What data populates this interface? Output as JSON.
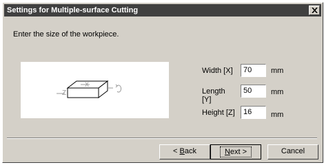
{
  "dialog": {
    "title": "Settings for Multiple-surface Cutting",
    "instruction": "Enter the size of the workpiece.",
    "preview": {
      "axis_z": "Z",
      "axis_x": "X"
    },
    "fields": [
      {
        "label": "Width [X]",
        "value": "70",
        "unit": "mm"
      },
      {
        "label": "Length [Y]",
        "value": "50",
        "unit": "mm"
      },
      {
        "label": "Height [Z]",
        "value": "16",
        "unit": "mm"
      }
    ],
    "buttons": {
      "back_prefix": "< ",
      "back_mnemonic": "B",
      "back_rest": "ack",
      "next_mnemonic": "N",
      "next_rest": "ext >",
      "cancel": "Cancel"
    }
  }
}
